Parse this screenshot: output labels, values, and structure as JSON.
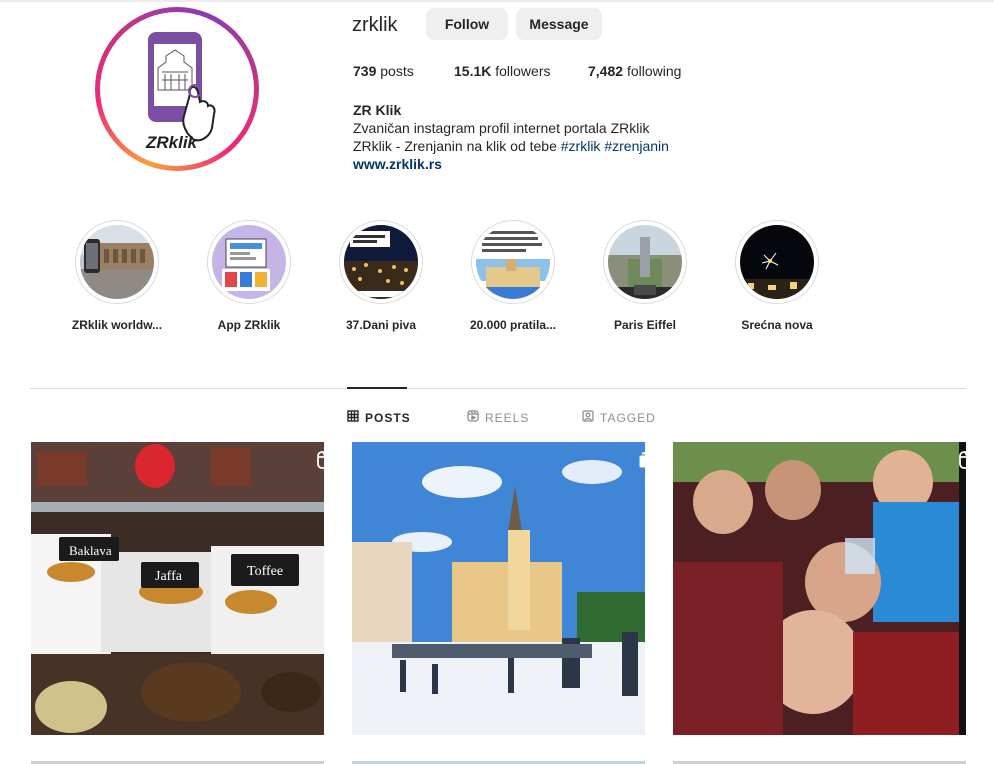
{
  "profile": {
    "username": "zrklik",
    "follow_label": "Follow",
    "message_label": "Message",
    "stats": {
      "posts_count": "739",
      "posts_label": "posts",
      "followers_count": "15.1K",
      "followers_label": "followers",
      "following_count": "7,482",
      "following_label": "following"
    },
    "bio": {
      "name": "ZR Klik",
      "line1": "Zvaničan instagram profil internet portala ZRklik",
      "line2_text": "ZRklik - Zrenjanin na klik od tebe",
      "hashtag1": "#zrklik",
      "hashtag2": "#zrenjanin",
      "website": "www.zrklik.rs"
    },
    "avatar_logo_text": "ZRklik"
  },
  "highlights": [
    {
      "label": "ZRklik worldw...",
      "icon": "arena-photo"
    },
    {
      "label": "App ZRklik",
      "icon": "app-screens"
    },
    {
      "label": "37.Dani piva",
      "icon": "concert-crowd"
    },
    {
      "label": "20.000 pratila...",
      "icon": "city-square"
    },
    {
      "label": "Paris Eiffel",
      "icon": "paris-view"
    },
    {
      "label": "Srećna nova",
      "icon": "fireworks"
    }
  ],
  "tabs": [
    {
      "label": "POSTS",
      "icon": "grid-icon",
      "active": true
    },
    {
      "label": "REELS",
      "icon": "reels-icon",
      "active": false
    },
    {
      "label": "TAGGED",
      "icon": "tagged-icon",
      "active": false
    }
  ],
  "posts": [
    {
      "subject": "pastry-display",
      "badge": "reel-icon",
      "signs": [
        "Baklava",
        "Jaffa",
        "Toffee"
      ]
    },
    {
      "subject": "church-square-foam-party",
      "badge": "carousel-icon"
    },
    {
      "subject": "team-celebration",
      "badge": "reel-icon"
    }
  ],
  "colors": {
    "button_bg": "#efefef",
    "link": "#00376b",
    "divider": "#dbdbdb",
    "muted": "#8e8e8e",
    "logo_purple": "#7b4ea3"
  }
}
